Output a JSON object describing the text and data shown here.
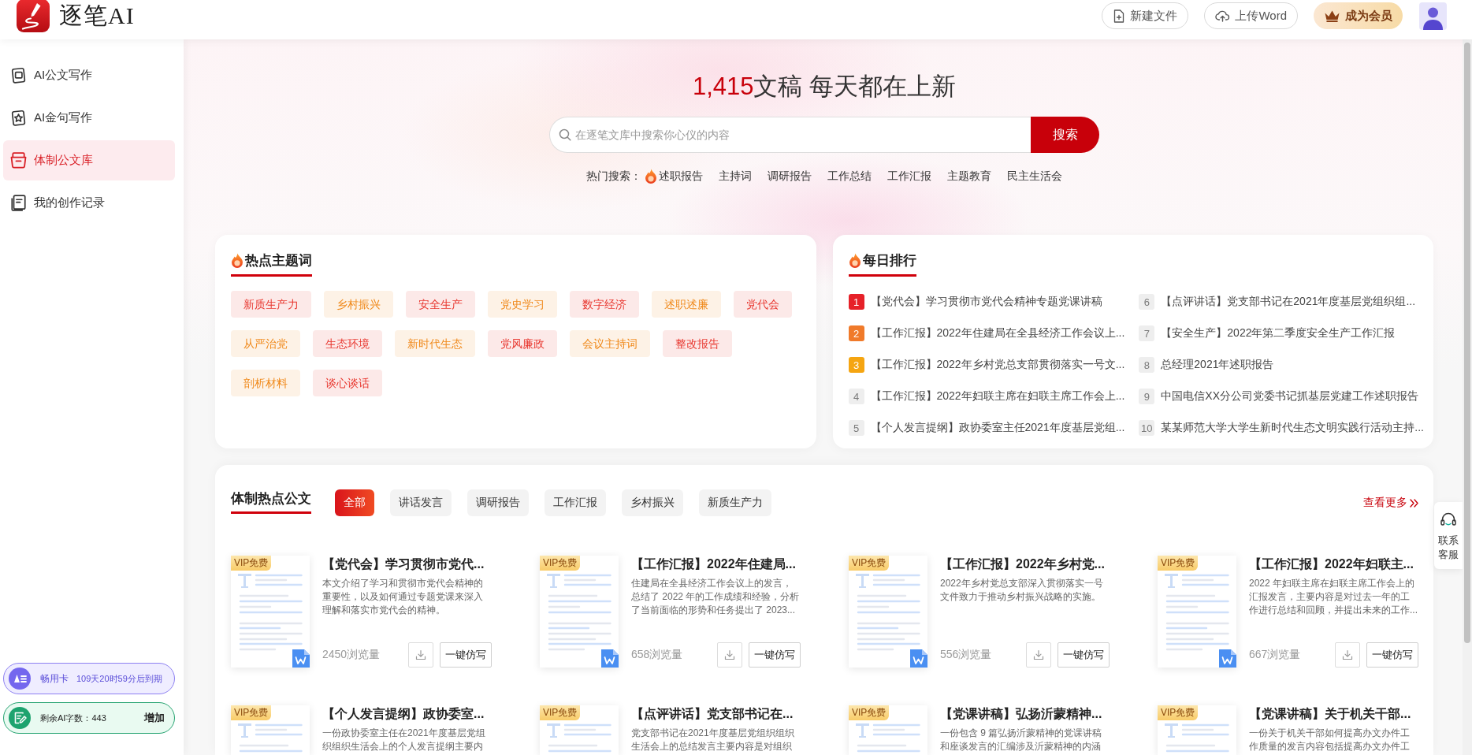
{
  "header": {
    "brand": "逐笔AI",
    "buttons": [
      {
        "kind": "new",
        "label": "新建文件"
      },
      {
        "kind": "upload",
        "label": "上传Word"
      },
      {
        "kind": "vip",
        "label": "成为会员"
      }
    ]
  },
  "sidebar": {
    "items": [
      {
        "kind": "ai-doc",
        "label": "AI公文写作",
        "selected": false
      },
      {
        "kind": "ai-quote",
        "label": "AI金句写作",
        "selected": false
      },
      {
        "kind": "library",
        "label": "体制公文库",
        "selected": true
      },
      {
        "kind": "history",
        "label": "我的创作记录",
        "selected": false
      }
    ],
    "membership": {
      "name": "畅用卡",
      "expiry": "109天20时59分后到期"
    },
    "quota": {
      "text": "剩余AI字数：443",
      "action": "增加"
    }
  },
  "hero": {
    "count": "1,415",
    "headline": "文稿 每天都在上新",
    "search": {
      "placeholder": "在逐笔文库中搜索你心仪的内容",
      "button": "搜索"
    },
    "hot_label": "热门搜索：",
    "hot_searches": [
      {
        "label": "述职报告",
        "hot": true
      },
      {
        "label": "主持词",
        "hot": false
      },
      {
        "label": "调研报告",
        "hot": false
      },
      {
        "label": "工作总结",
        "hot": false
      },
      {
        "label": "工作汇报",
        "hot": false
      },
      {
        "label": "主题教育",
        "hot": false
      },
      {
        "label": "民主生活会",
        "hot": false
      }
    ]
  },
  "topics": {
    "title": "热点主题词",
    "tags": [
      {
        "label": "新质生产力",
        "color": "#e8372f"
      },
      {
        "label": "乡村振兴",
        "color": "#f08a1c"
      },
      {
        "label": "安全生产",
        "color": "#e8372f"
      },
      {
        "label": "党史学习",
        "color": "#f08a1c"
      },
      {
        "label": "数字经济",
        "color": "#e8372f"
      },
      {
        "label": "述职述廉",
        "color": "#f08a1c"
      },
      {
        "label": "党代会",
        "color": "#e8372f"
      },
      {
        "label": "从严治党",
        "color": "#f08a1c"
      },
      {
        "label": "生态环境",
        "color": "#e8372f"
      },
      {
        "label": "新时代生态",
        "color": "#f08a1c"
      },
      {
        "label": "党风廉政",
        "color": "#e8372f"
      },
      {
        "label": "会议主持词",
        "color": "#f08a1c"
      },
      {
        "label": "整改报告",
        "color": "#e8372f"
      },
      {
        "label": "剖析材料",
        "color": "#f08a1c"
      },
      {
        "label": "谈心谈话",
        "color": "#e8372f"
      }
    ]
  },
  "ranking": {
    "title": "每日排行",
    "items": [
      {
        "rank": "1",
        "title": "【党代会】学习贯彻市党代会精神专题党课讲稿",
        "color": "#e62129"
      },
      {
        "rank": "2",
        "title": "【工作汇报】2022年住建局在全县经济工作会议上...",
        "color": "#f07a2a"
      },
      {
        "rank": "3",
        "title": "【工作汇报】2022年乡村党总支部贯彻落实一号文...",
        "color": "#f5a511"
      },
      {
        "rank": "4",
        "title": "【工作汇报】2022年妇联主席在妇联主席工作会上...",
        "color": "#eeeeee"
      },
      {
        "rank": "5",
        "title": "【个人发言提纲】政协委室主任2021年度基层党组...",
        "color": "#eeeeee"
      },
      {
        "rank": "6",
        "title": "【点评讲话】党支部书记在2021年度基层党组织组...",
        "color": "#eeeeee"
      },
      {
        "rank": "7",
        "title": "【安全生产】2022年第二季度安全生产工作汇报",
        "color": "#eeeeee"
      },
      {
        "rank": "8",
        "title": "总经理2021年述职报告",
        "color": "#eeeeee"
      },
      {
        "rank": "9",
        "title": "中国电信XX分公司党委书记抓基层党建工作述职报告",
        "color": "#eeeeee"
      },
      {
        "rank": "10",
        "title": "某某师范大学大学生新时代生态文明实践行活动主持...",
        "color": "#eeeeee"
      }
    ]
  },
  "featured": {
    "title": "体制热点公文",
    "filters": [
      {
        "label": "全部",
        "selected": true
      },
      {
        "label": "讲话发言",
        "selected": false
      },
      {
        "label": "调研报告",
        "selected": false
      },
      {
        "label": "工作汇报",
        "selected": false
      },
      {
        "label": "乡村振兴",
        "selected": false
      },
      {
        "label": "新质生产力",
        "selected": false
      }
    ],
    "more": "查看更多",
    "docs": [
      {
        "badge": "VIP免费",
        "title": "【党代会】学习贯彻市党代...",
        "summary": "本文介绍了学习和贯彻市党代会精神的重要性，以及如何通过专题党课来深入理解和落实市党代会的精神。",
        "views": "2450浏览量",
        "action": "一键仿写"
      },
      {
        "badge": "VIP免费",
        "title": "【工作汇报】2022年住建局...",
        "summary": "住建局在全县经济工作会议上的发言，总结了 2022 年的工作成绩和经验，分析了当前面临的形势和任务提出了 2023...",
        "views": "658浏览量",
        "action": "一键仿写"
      },
      {
        "badge": "VIP免费",
        "title": "【工作汇报】2022年乡村党...",
        "summary": "2022年乡村党总支部深入贯彻落实一号文件致力于推动乡村振兴战略的实施。",
        "views": "556浏览量",
        "action": "一键仿写"
      },
      {
        "badge": "VIP免费",
        "title": "【工作汇报】2022年妇联主...",
        "summary": "2022 年妇联主席在妇联主席工作会上的汇报发言，主要内容是对过去一年的工作进行总结和回顾，并提出未来的工作...",
        "views": "667浏览量",
        "action": "一键仿写"
      },
      {
        "badge": "VIP免费",
        "title": "【个人发言提纲】政协委室...",
        "summary": "一份政协委室主任在2021年度基层党组织组织生活会上的个人发言提纲主要内"
      },
      {
        "badge": "VIP免费",
        "title": "【点评讲话】党支部书记在...",
        "summary": "党支部书记在2021年度基层党组织组织生活会上的总结发言主要内容是对组织"
      },
      {
        "badge": "VIP免费",
        "title": "【党课讲稿】弘扬沂蒙精神...",
        "summary": "一份包含 9 篇弘扬沂蒙精神的党课讲稿和座谈发言的汇编涉及沂蒙精神的内涵"
      },
      {
        "badge": "VIP免费",
        "title": "【党课讲稿】关于机关干部...",
        "summary": "一份关于机关干部如何提高办文办件工作质量的发言内容包括提高办文办件工"
      }
    ]
  },
  "support": {
    "label": "联系客服"
  }
}
